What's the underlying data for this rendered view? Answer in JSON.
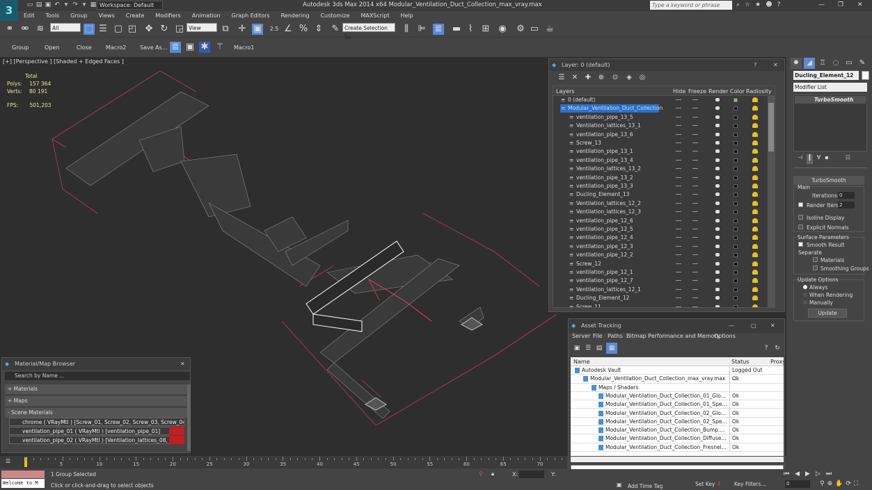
{
  "app": {
    "logo": "3",
    "title": "Autodesk 3ds Max  2014 x64      Modular_Ventilation_Duct_Collection_max_vray.max",
    "workspace": "Workspace: Default",
    "search_placeholder": "Type a keyword or phrase"
  },
  "menu": [
    "Edit",
    "Tools",
    "Group",
    "Views",
    "Create",
    "Modifiers",
    "Animation",
    "Graph Editors",
    "Rendering",
    "Customize",
    "MAXScript",
    "Help"
  ],
  "toolbar": {
    "filter": "All",
    "refcoord": "View",
    "selset": "Create Selection Se",
    "snap_label": "2.5",
    "percent": "%"
  },
  "toolbar2": [
    "Group",
    "Open",
    "Close",
    "Macro2",
    "Save As...",
    "Macro1"
  ],
  "viewport": {
    "label": "[+] [Perspective ] [Shaded + Edged Faces ]",
    "stats_header": "Total",
    "polys_label": "Polys:",
    "polys": "157 364",
    "verts_label": "Verts:",
    "verts": "80 191",
    "fps_label": "FPS:",
    "fps": "501,203"
  },
  "layer": {
    "title": "Layer: 0 (default)",
    "help": "?",
    "columns": [
      "Layers",
      "Hide",
      "Freeze",
      "Render",
      "Color",
      "Radiosity"
    ],
    "default": "0 (default)",
    "selected": "Modular_Ventilation_Duct_Collection",
    "items": [
      "ventilation_pipe_13_5",
      "Ventilation_lattices_13_1",
      "ventilation_pipe_13_6",
      "Screw_13",
      "ventilation_pipe_13_1",
      "ventilation_pipe_13_4",
      "Ventilation_lattices_13_2",
      "ventilation_pipe_13_2",
      "ventilation_pipe_13_3",
      "Ducling_Element_13",
      "Ventilation_lattices_12_2",
      "Ventilation_lattices_12_3",
      "ventilation_pipe_12_6",
      "ventilation_pipe_12_5",
      "ventilation_pipe_12_4",
      "ventilation_pipe_12_3",
      "ventilation_pipe_12_2",
      "Screw_12",
      "ventilation_pipe_12_1",
      "ventilation_pipe_12_7",
      "Ventilation_lattices_12_1",
      "Ducling_Element_12",
      "Screw_11"
    ]
  },
  "asset": {
    "title": "Asset Tracking",
    "menu": [
      "Server",
      "File",
      "Paths",
      "Bitmap Performance and Memory",
      "Options"
    ],
    "columns": [
      "Name",
      "Status",
      "Proxy"
    ],
    "rows": [
      {
        "name": "Autodesk Vault",
        "status": "Logged Out ...",
        "indent": 16
      },
      {
        "name": "Modular_Ventilation_Duct_Collection_max_vray.max",
        "status": "Ok",
        "indent": 28
      },
      {
        "name": "Maps / Shaders",
        "status": "",
        "indent": 40
      },
      {
        "name": "Modular_Ventilation_Duct_Collection_01_Glo...",
        "status": "Ok",
        "indent": 50
      },
      {
        "name": "Modular_Ventilation_Duct_Collection_01_Spe...",
        "status": "Ok",
        "indent": 50
      },
      {
        "name": "Modular_Ventilation_Duct_Collection_02_Glo...",
        "status": "Ok",
        "indent": 50
      },
      {
        "name": "Modular_Ventilation_Duct_Collection_02_Spe...",
        "status": "Ok",
        "indent": 50
      },
      {
        "name": "Modular_Ventilation_Duct_Collection_Bump....",
        "status": "Ok",
        "indent": 50
      },
      {
        "name": "Modular_Ventilation_Duct_Collection_Diffuse...",
        "status": "Ok",
        "indent": 50
      },
      {
        "name": "Modular_Ventilation_Duct_Collection_Fresnel...",
        "status": "Ok",
        "indent": 50
      }
    ]
  },
  "matbrowser": {
    "title": "Material/Map Browser",
    "search": "Search by Name ...",
    "sections": [
      "+ Materials",
      "+ Maps",
      "- Scene Materials"
    ],
    "items": [
      "chrome  ( VRayMtl ) [Screw_01, Screw_02, Screw_03, Screw_04, Sc...",
      "ventilation_pipe_01  ( VRayMtl ) [ventilation_pipe_01]",
      "ventilation_pipe_02  ( VRayMtl ) [Ventilation_lattices_08, Ventilation..."
    ]
  },
  "cmdpanel": {
    "object_name": "Ducling_Element_12",
    "modifier_list": "Modifier List",
    "stack_item": "TurboSmooth",
    "turbosmooth": {
      "title": "TurboSmooth",
      "main": "Main",
      "iterations_label": "Iterations:",
      "iterations": "0",
      "render_iters_label": "Render Iters:",
      "render_iters": "2",
      "isoline": "Isoline Display",
      "explicit": "Explicit Normals",
      "surface": "Surface Parameters",
      "smooth": "Smooth Result",
      "separate": "Separate",
      "materials": "Materials",
      "smoothing": "Smoothing Groups",
      "update_options": "Update Options",
      "always": "Always",
      "when_rendering": "When Rendering",
      "manually": "Manually",
      "update": "Update"
    }
  },
  "timeline": {
    "ticks": [
      "5",
      "10",
      "15",
      "20",
      "25",
      "30",
      "35",
      "40",
      "45",
      "50",
      "55",
      "60",
      "65",
      "70"
    ]
  },
  "status": {
    "welcome": "Welcome to M",
    "selected": "1 Group Selected",
    "prompt": "Click or click-and-drag to select objects",
    "x_label": "X:",
    "y_label": "Y:",
    "add_time_tag": "Add Time Tag",
    "set_key": "Set Key",
    "key_filters": "Key Filters...",
    "frame": "0"
  }
}
